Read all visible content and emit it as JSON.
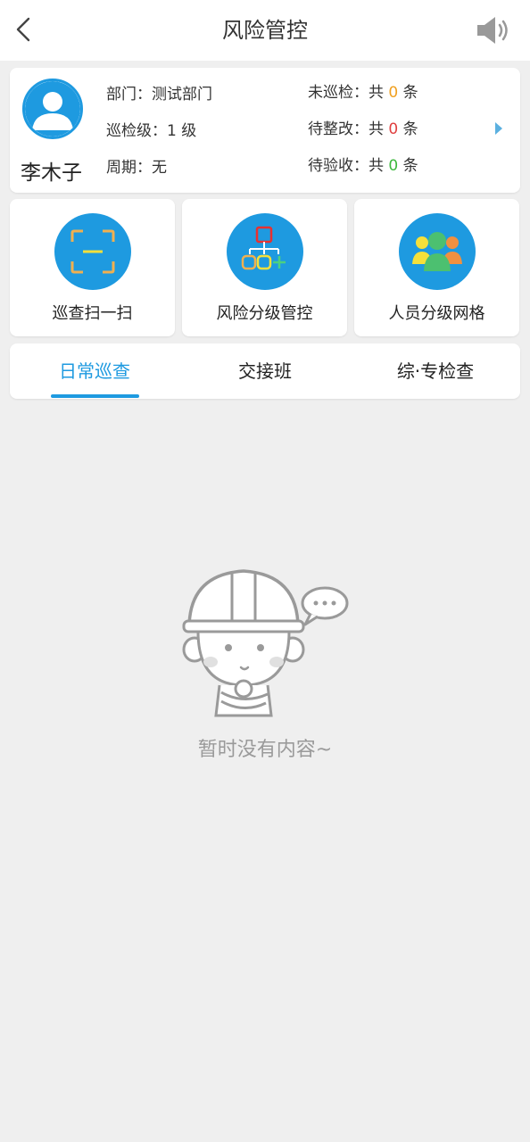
{
  "header": {
    "title": "风险管控",
    "back_icon": "chevron-left-icon",
    "speaker_icon": "speaker-icon"
  },
  "profile": {
    "name": "李木子",
    "department_label": "部门：",
    "department_value": "测试部门",
    "level_label": "巡检级：",
    "level_value": "1 级",
    "cycle_label": "周期：",
    "cycle_value": "无",
    "stats": [
      {
        "label": "未巡检：",
        "prefix": "共 ",
        "count": "0",
        "suffix": " 条",
        "color": "#f0a020"
      },
      {
        "label": "待整改：",
        "prefix": "共 ",
        "count": "0",
        "suffix": " 条",
        "color": "#e04040"
      },
      {
        "label": "待验收：",
        "prefix": "共 ",
        "count": "0",
        "suffix": " 条",
        "color": "#3db83d"
      }
    ]
  },
  "tiles": [
    {
      "label": "巡查扫一扫",
      "icon": "scan-icon"
    },
    {
      "label": "风险分级管控",
      "icon": "hierarchy-icon"
    },
    {
      "label": "人员分级网格",
      "icon": "people-group-icon"
    }
  ],
  "tabs": [
    {
      "label": "日常巡查",
      "active": true
    },
    {
      "label": "交接班",
      "active": false
    },
    {
      "label": "综·专检查",
      "active": false
    }
  ],
  "empty_state": {
    "message": "暂时没有内容~",
    "illustration": "worker-helmet-illustration"
  },
  "colors": {
    "accent": "#1e9ae0",
    "background": "#efefef"
  }
}
